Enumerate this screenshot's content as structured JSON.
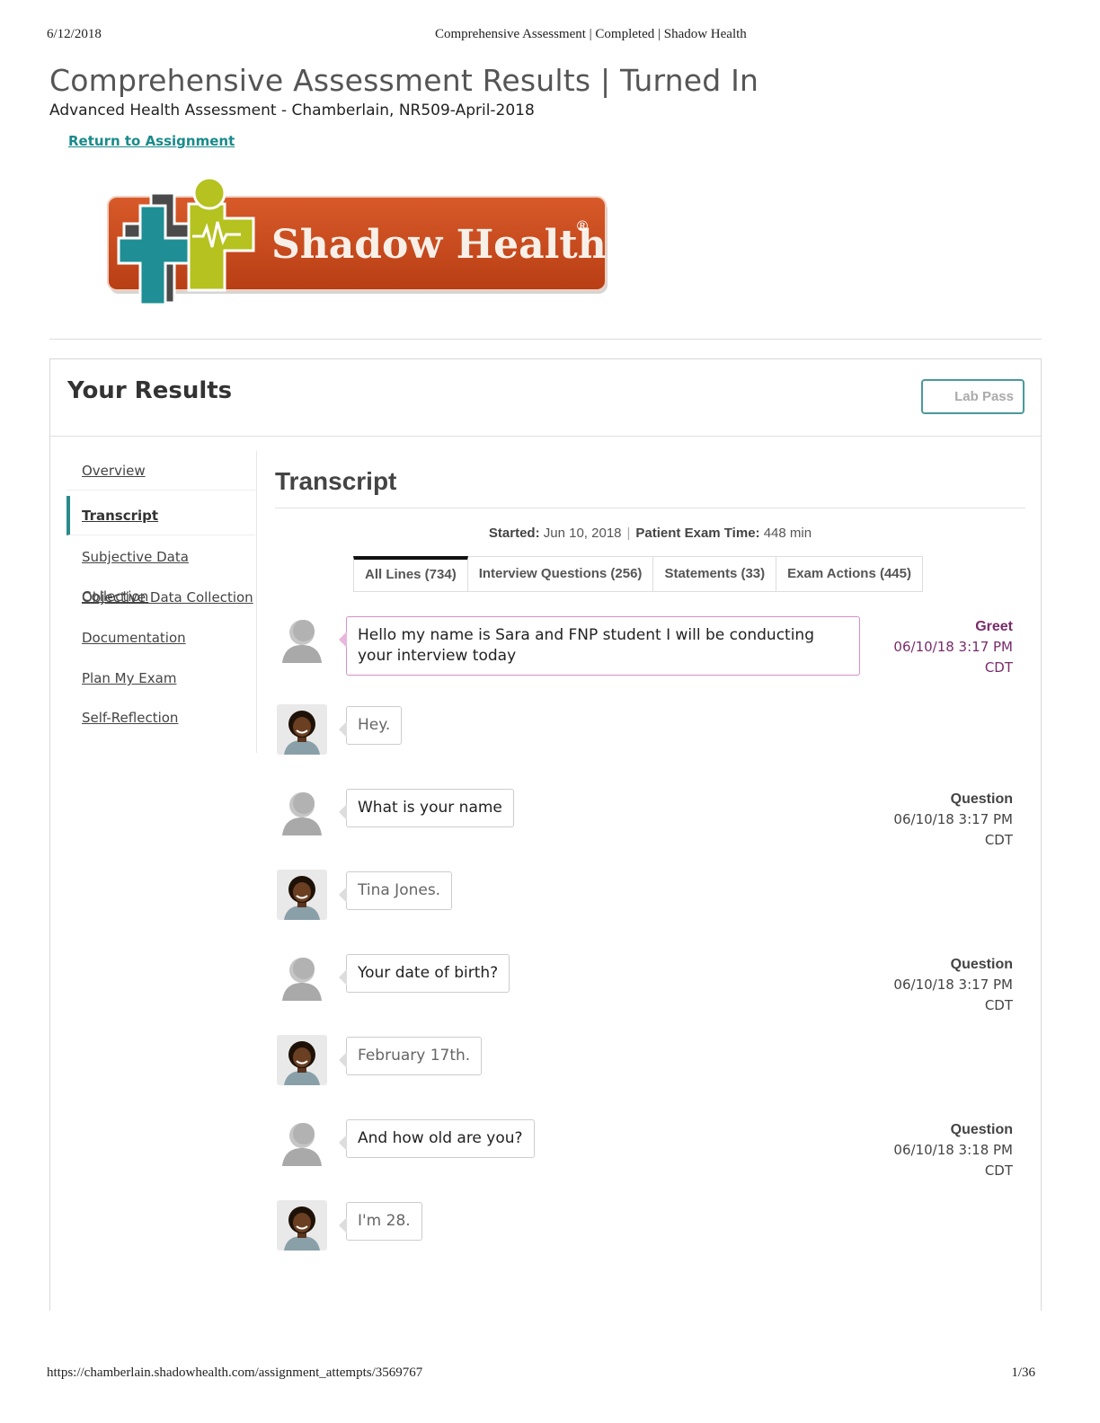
{
  "print": {
    "date": "6/12/2018",
    "title": "Comprehensive Assessment | Completed | Shadow Health",
    "url": "https://chamberlain.shadowhealth.com/assignment_attempts/3569767",
    "page": "1/36"
  },
  "header": {
    "title": "Comprehensive Assessment Results | Turned In",
    "subtitle": "Advanced Health Assessment - Chamberlain, NR509-April-2018",
    "return_link": "Return to Assignment"
  },
  "logo": {
    "text": "Shadow Health",
    "registered": "®",
    "colors": {
      "banner": "#c8491c",
      "teal": "#1f8f95",
      "lime": "#b5c21f",
      "dark": "#4a4a4a"
    }
  },
  "results": {
    "title": "Your Results",
    "lab_pass": "Lab Pass"
  },
  "sidebar": {
    "items": [
      {
        "label": "Overview",
        "active": false
      },
      {
        "label": "Transcript",
        "active": true
      },
      {
        "label": "Subjective Data Collection",
        "active": false
      },
      {
        "label": "Objective Data Collection",
        "active": false
      },
      {
        "label": "Documentation",
        "active": false
      },
      {
        "label": "Plan My Exam",
        "active": false
      },
      {
        "label": "Self-Reflection",
        "active": false
      }
    ]
  },
  "transcript": {
    "title": "Transcript",
    "started_label": "Started:",
    "started_value": "Jun 10, 2018",
    "exam_time_label": "Patient Exam Time:",
    "exam_time_value": "448 min",
    "tabs": [
      {
        "label": "All Lines (734)",
        "active": true
      },
      {
        "label": "Interview Questions (256)",
        "active": false
      },
      {
        "label": "Statements (33)",
        "active": false
      },
      {
        "label": "Exam Actions (445)",
        "active": false
      }
    ],
    "messages": [
      {
        "speaker": "student",
        "text": "Hello my name is Sara and FNP student I will be conducting your interview today",
        "type": "Greet",
        "time": "06/10/18 3:17 PM",
        "tz": "CDT"
      },
      {
        "speaker": "patient",
        "text": "Hey.",
        "type": "",
        "time": "",
        "tz": ""
      },
      {
        "speaker": "student",
        "text": "What is your name",
        "type": "Question",
        "time": "06/10/18 3:17 PM",
        "tz": "CDT"
      },
      {
        "speaker": "patient",
        "text": "Tina Jones.",
        "type": "",
        "time": "",
        "tz": ""
      },
      {
        "speaker": "student",
        "text": "Your date of birth?",
        "type": "Question",
        "time": "06/10/18 3:17 PM",
        "tz": "CDT"
      },
      {
        "speaker": "patient",
        "text": "February 17th.",
        "type": "",
        "time": "",
        "tz": ""
      },
      {
        "speaker": "student",
        "text": "And how old are you?",
        "type": "Question",
        "time": "06/10/18 3:18 PM",
        "tz": "CDT"
      },
      {
        "speaker": "patient",
        "text": "I'm 28.",
        "type": "",
        "time": "",
        "tz": ""
      }
    ]
  },
  "icons": {
    "student_avatar": "student-silhouette-icon",
    "patient_avatar": "patient-avatar-icon"
  }
}
